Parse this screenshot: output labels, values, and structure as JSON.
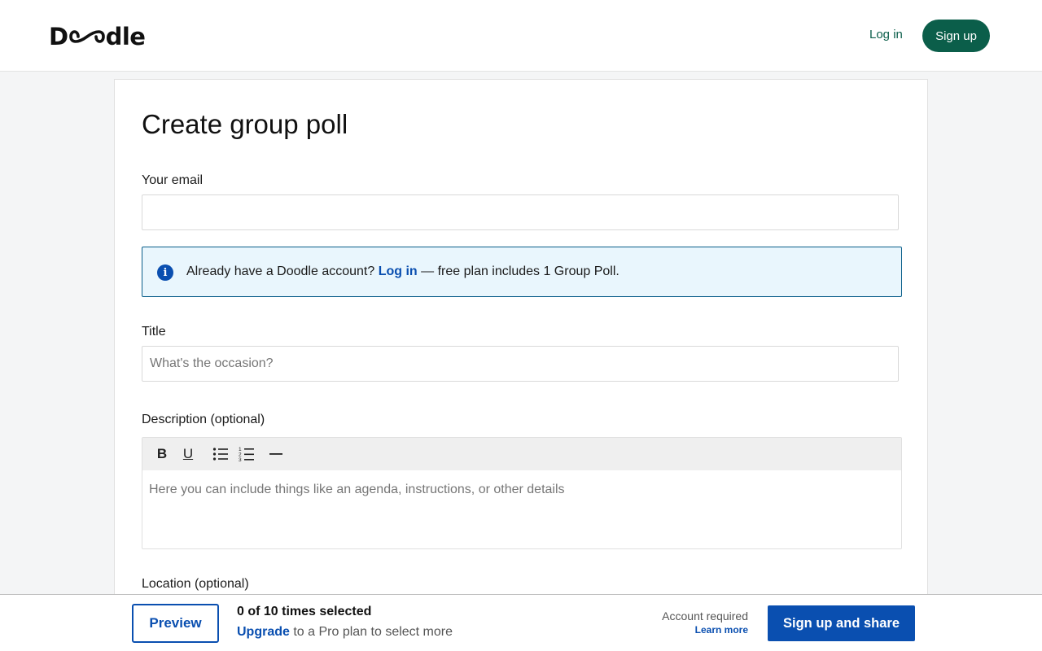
{
  "header": {
    "logo_text": "Doodle",
    "login_label": "Log in",
    "signup_label": "Sign up"
  },
  "form": {
    "title": "Create group poll",
    "email": {
      "label": "Your email",
      "value": "",
      "placeholder": ""
    },
    "info": {
      "text_before": "Already have a Doodle account? ",
      "link": "Log in",
      "text_after": " — free plan includes 1 Group Poll."
    },
    "poll_title": {
      "label": "Title",
      "value": "",
      "placeholder": "What's the occasion?"
    },
    "description": {
      "label": "Description (optional)",
      "placeholder": "Here you can include things like an agenda, instructions, or other details",
      "toolbar": {
        "bold": "B",
        "underline": "U"
      }
    },
    "location": {
      "label": "Location (optional)"
    }
  },
  "bottom_bar": {
    "preview_label": "Preview",
    "count_text": "0 of 10 times selected",
    "upgrade_link": "Upgrade",
    "upgrade_rest": " to a Pro plan to select more",
    "account_required": "Account required",
    "learn_more": "Learn more",
    "share_label": "Sign up and share"
  },
  "colors": {
    "brand_green": "#0b5e4a",
    "primary_blue": "#0a4fb0",
    "info_bg": "#e9f6fd"
  },
  "icons": [
    "info-icon",
    "bold-icon",
    "underline-icon",
    "bullet-list-icon",
    "numbered-list-icon",
    "horizontal-rule-icon"
  ]
}
